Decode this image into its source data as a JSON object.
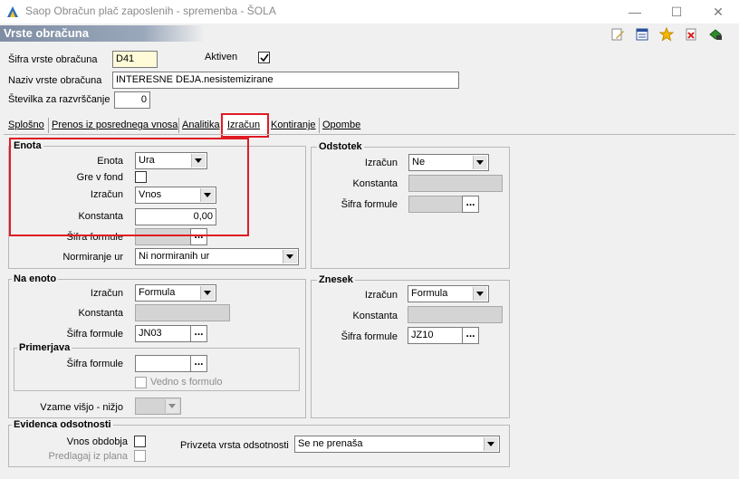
{
  "window": {
    "title": "Saop Obračun plač zaposlenih - spremenba - ŠOLA",
    "minimize": "—",
    "maximize": "☐",
    "close": "✕"
  },
  "header": {
    "title": "Vrste obračuna"
  },
  "toolbar": {
    "icons": [
      "edit-icon",
      "list-icon",
      "star-icon",
      "delete-icon",
      "exit-icon"
    ]
  },
  "form": {
    "sifra_label": "Šifra vrste obračuna",
    "sifra_value": "D41",
    "aktiven_label": "Aktiven",
    "aktiven_checked": true,
    "naziv_label": "Naziv vrste obračuna",
    "naziv_value": "INTERESNE DEJA.nesistemizirane",
    "stevilka_label": "Številka  za razvrščanje",
    "stevilka_value": "0"
  },
  "tabs": [
    "Splošno",
    "Prenos iz posrednega vnosa",
    "Analitika",
    "Izračun",
    "Kontiranje",
    "Opombe"
  ],
  "active_tab": "Izračun",
  "enota": {
    "title": "Enota",
    "enota_label": "Enota",
    "enota_value": "Ura",
    "gre_label": "Gre v fond",
    "izracun_label": "Izračun",
    "izracun_value": "Vnos",
    "konstanta_label": "Konstanta",
    "konstanta_value": "0,00",
    "sifra_label": "Šifra formule",
    "sifra_value": "",
    "normiranje_label": "Normiranje ur",
    "normiranje_value": "Ni normiranih ur"
  },
  "odstotek": {
    "title": "Odstotek",
    "izracun_label": "Izračun",
    "izracun_value": "Ne",
    "konstanta_label": "Konstanta",
    "sifra_label": "Šifra formule"
  },
  "na_enoto": {
    "title": "Na enoto",
    "izracun_label": "Izračun",
    "izracun_value": "Formula",
    "konstanta_label": "Konstanta",
    "sifra_label": "Šifra formule",
    "sifra_value": "JN03",
    "primerjava_title": "Primerjava",
    "primerjava_sifra_label": "Šifra formule",
    "vedno_label": "Vedno s formulo",
    "vzame_label": "Vzame višjo - nižjo"
  },
  "znesek": {
    "title": "Znesek",
    "izracun_label": "Izračun",
    "izracun_value": "Formula",
    "konstanta_label": "Konstanta",
    "sifra_label": "Šifra formule",
    "sifra_value": "JZ10"
  },
  "evidenca": {
    "title": "Evidenca odsotnosti",
    "vnos_label": "Vnos obdobja",
    "predlagaj_label": "Predlagaj iz plana",
    "privzeta_label": "Privzeta vrsta odsotnosti",
    "privzeta_value": "Se ne prenaša"
  },
  "colors": {
    "highlight": "#e01b24",
    "header_gradient": "#7f8da3"
  }
}
